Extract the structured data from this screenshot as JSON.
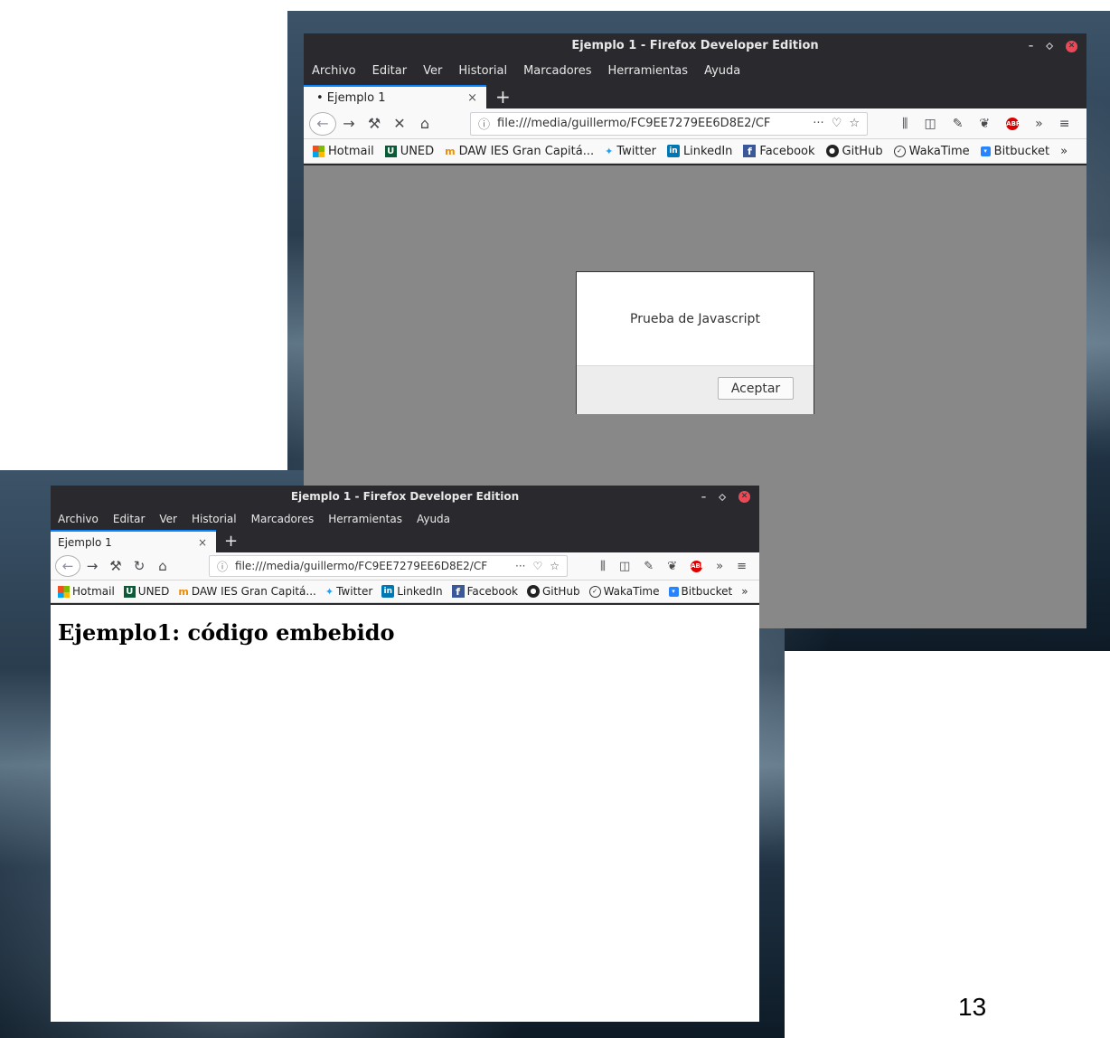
{
  "window_title": "Ejemplo 1 - Firefox Developer Edition",
  "menu": [
    {
      "label": "Archivo"
    },
    {
      "label": "Editar"
    },
    {
      "label": "Ver"
    },
    {
      "label": "Historial"
    },
    {
      "label": "Marcadores"
    },
    {
      "label": "Herramientas"
    },
    {
      "label": "Ayuda"
    }
  ],
  "tab": {
    "label_top": "• Ejemplo 1",
    "label_bottom": "Ejemplo 1",
    "close": "×",
    "new_tab": "+"
  },
  "url": {
    "info": "ⓘ",
    "text": "file:///media/guillermo/FC9EE7279EE6D8E2/CF",
    "more": "···"
  },
  "bookmarks": [
    {
      "label": "Hotmail",
      "icon": "hotmail-icon"
    },
    {
      "label": "UNED",
      "icon": "uned-icon"
    },
    {
      "label": "DAW IES Gran Capitá...",
      "icon": "daw-icon"
    },
    {
      "label": "Twitter",
      "icon": "twitter-icon"
    },
    {
      "label": "LinkedIn",
      "icon": "linkedin-icon"
    },
    {
      "label": "Facebook",
      "icon": "facebook-icon"
    },
    {
      "label": "GitHub",
      "icon": "github-icon"
    },
    {
      "label": "WakaTime",
      "icon": "wakatime-icon"
    },
    {
      "label": "Bitbucket",
      "icon": "bitbucket-icon"
    }
  ],
  "alert": {
    "message": "Prueba de Javascript",
    "button": "Aceptar"
  },
  "page": {
    "heading": "Ejemplo1: código embebido"
  },
  "slide_number": "13",
  "colors": {
    "chrome": "#2a2a2e",
    "toolbar": "#f9f9fa",
    "accent": "#0a84ff",
    "overlay": "#888888"
  }
}
